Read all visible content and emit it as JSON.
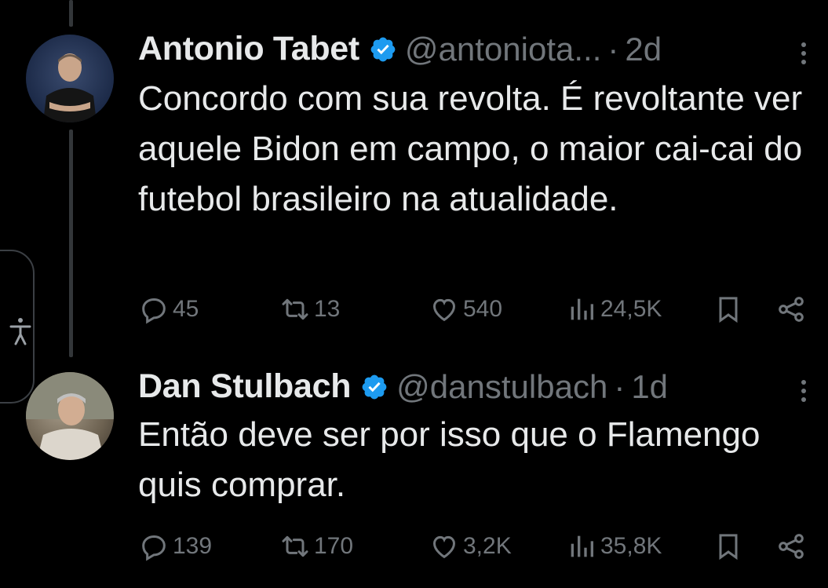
{
  "tweets": [
    {
      "name": "Antonio Tabet",
      "handle": "@antoniota...",
      "separator": "·",
      "time": "2d",
      "text": "Concordo com sua revolta. É revoltante ver aquele Bidon em campo, o maior cai-cai do futebol brasileiro na atualidade.",
      "replies": "45",
      "reposts": "13",
      "likes": "540",
      "views": "24,5K"
    },
    {
      "name": "Dan Stulbach",
      "handle": "@danstulbach",
      "separator": "·",
      "time": "1d",
      "text": "Então deve ser por isso que o Flamengo quis comprar.",
      "replies": "139",
      "reposts": "170",
      "likes": "3,2K",
      "views": "35,8K"
    }
  ],
  "colors": {
    "background": "#000000",
    "text": "#e7e9ea",
    "muted": "#71767b",
    "verified": "#1d9bf0"
  },
  "icons": [
    "reply-icon",
    "repost-icon",
    "like-icon",
    "views-icon",
    "bookmark-icon",
    "share-icon",
    "more-icon",
    "verified-badge-icon",
    "accessibility-icon"
  ]
}
